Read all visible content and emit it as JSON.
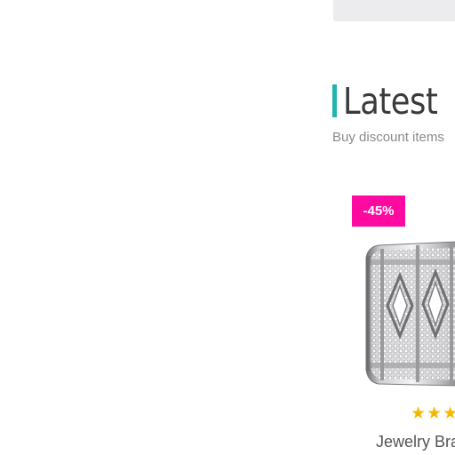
{
  "section": {
    "title": "Latest",
    "subtitle": "Buy discount items"
  },
  "product": {
    "discount_badge": "-45%",
    "name": "Jewelry Bra",
    "rating_stars_visible": 3,
    "image_icon": "bracelet-image"
  },
  "colors": {
    "accent": "#1fb5b0",
    "badge": "#ff0aa0",
    "star": "#f5b800",
    "title": "#3a3a3a",
    "top_bar": "#ececee"
  }
}
